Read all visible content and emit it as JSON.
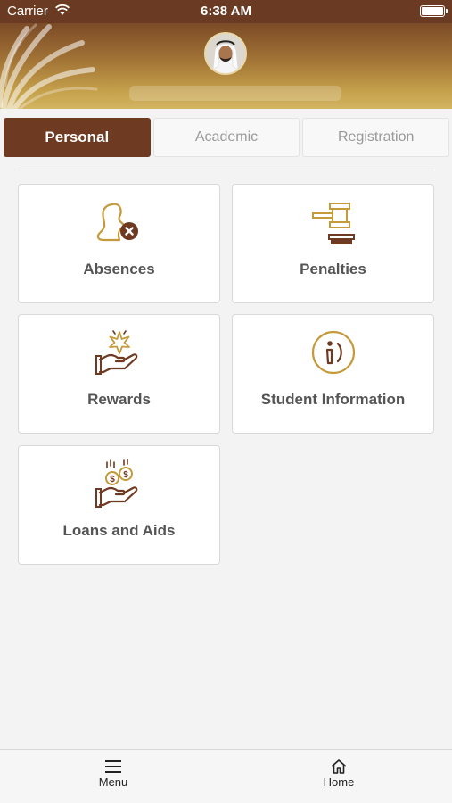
{
  "status_bar": {
    "carrier": "Carrier",
    "time": "6:38 AM"
  },
  "header": {
    "avatar_icon": "user-avatar-photo",
    "name": ""
  },
  "tabs": [
    {
      "label": "Personal",
      "active": true
    },
    {
      "label": "Academic",
      "active": false
    },
    {
      "label": "Registration",
      "active": false
    }
  ],
  "cards": [
    {
      "label": "Absences",
      "icon": "absence-person-icon"
    },
    {
      "label": "Penalties",
      "icon": "gavel-icon"
    },
    {
      "label": "Rewards",
      "icon": "reward-hand-star-icon"
    },
    {
      "label": "Student Information",
      "icon": "info-circle-icon"
    },
    {
      "label": "Loans and Aids",
      "icon": "hand-coins-icon"
    }
  ],
  "bottom_nav": {
    "menu_label": "Menu",
    "home_label": "Home"
  },
  "colors": {
    "brand_brown": "#6e3a21",
    "gold": "#c49a3a",
    "header_top": "#7b4a27"
  }
}
